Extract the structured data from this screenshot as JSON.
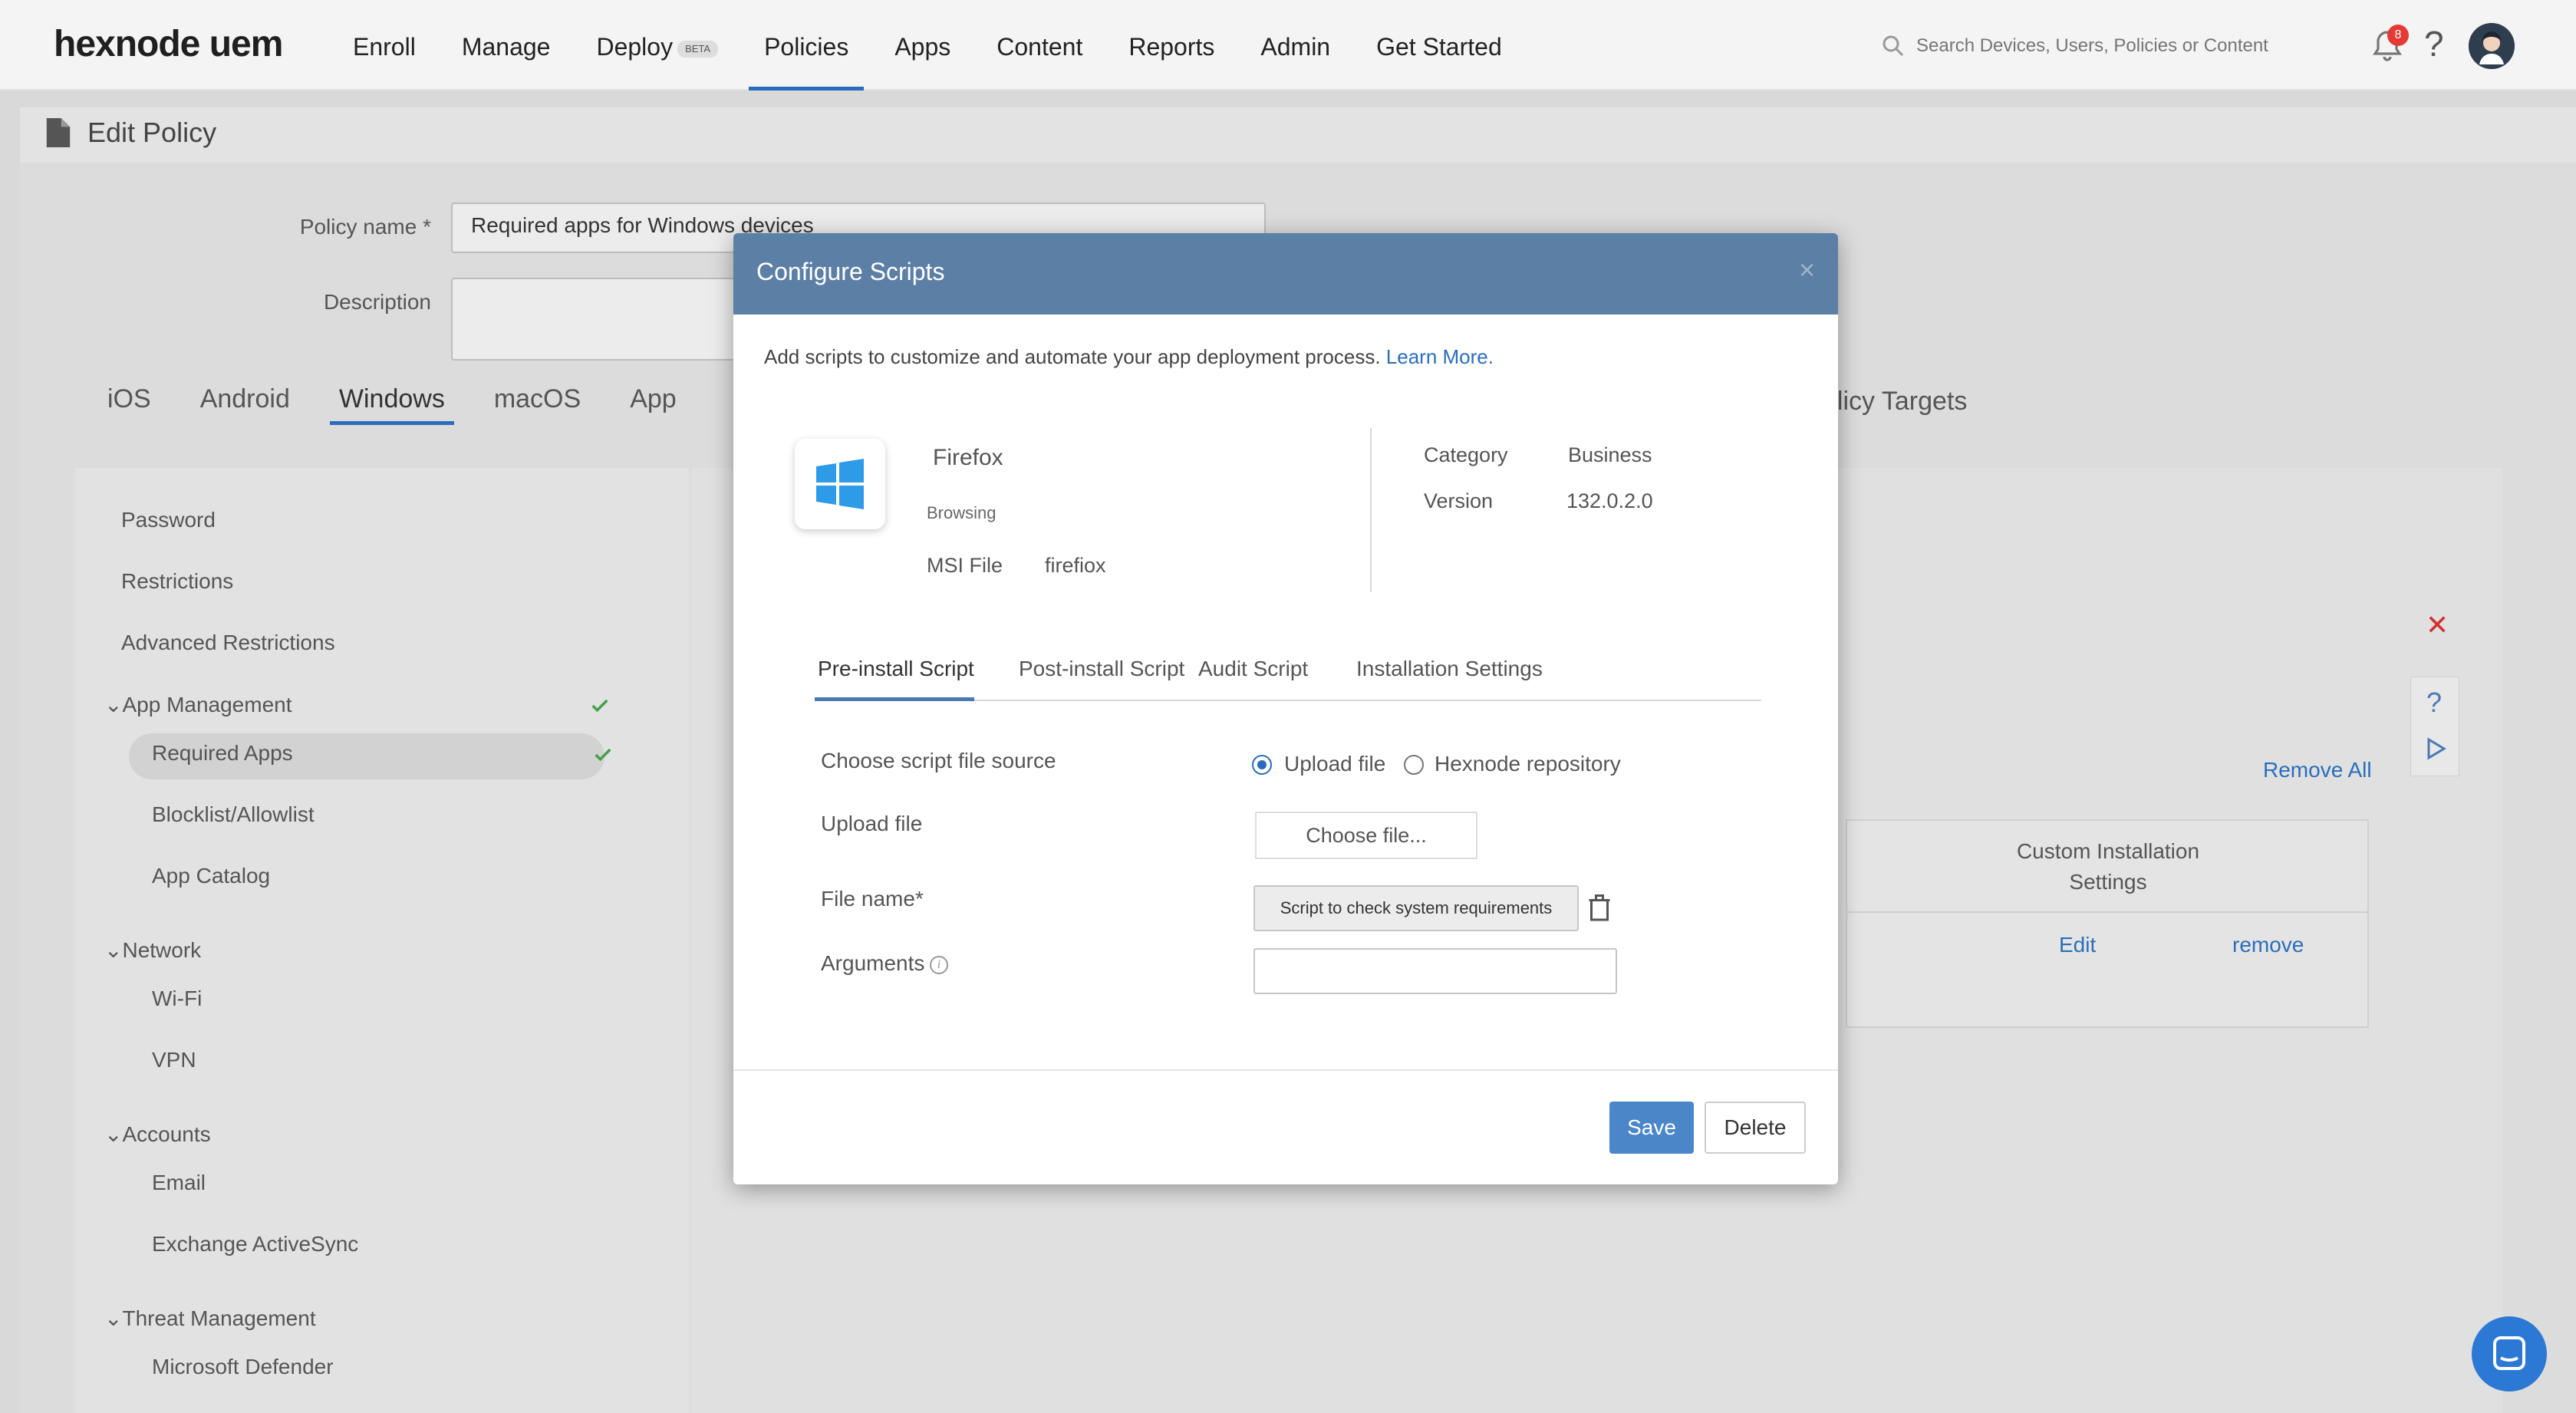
{
  "brand": {
    "logo": "hexnode uem"
  },
  "nav": {
    "items": [
      {
        "label": "Enroll"
      },
      {
        "label": "Manage"
      },
      {
        "label": "Deploy",
        "badge": "BETA"
      },
      {
        "label": "Policies",
        "active": true
      },
      {
        "label": "Apps"
      },
      {
        "label": "Content"
      },
      {
        "label": "Reports"
      },
      {
        "label": "Admin"
      },
      {
        "label": "Get Started"
      }
    ],
    "search_placeholder": "Search Devices, Users, Policies or Content",
    "notification_count": "8",
    "help": "?"
  },
  "page": {
    "title": "Edit Policy",
    "policy_name_label": "Policy name *",
    "policy_name_value": "Required apps for Windows devices",
    "description_label": "Description",
    "os_tabs": [
      "iOS",
      "Android",
      "Windows",
      "macOS",
      "App"
    ],
    "active_os_tab": "Windows",
    "policy_targets": "olicy Targets"
  },
  "sidebar": {
    "items": [
      {
        "label": "Password"
      },
      {
        "label": "Restrictions"
      },
      {
        "label": "Advanced Restrictions"
      }
    ],
    "app_management": {
      "label": "App Management",
      "items": [
        {
          "label": "Required Apps"
        },
        {
          "label": "Blocklist/Allowlist"
        },
        {
          "label": "App Catalog"
        }
      ]
    },
    "network": {
      "label": "Network",
      "items": [
        {
          "label": "Wi-Fi"
        },
        {
          "label": "VPN"
        }
      ]
    },
    "accounts": {
      "label": "Accounts",
      "items": [
        {
          "label": "Email"
        },
        {
          "label": "Exchange ActiveSync"
        }
      ]
    },
    "threat": {
      "label": "Threat Management",
      "items": [
        {
          "label": "Microsoft Defender"
        }
      ]
    }
  },
  "content": {
    "remove_all": "Remove All",
    "column_header_line1": "Custom Installation",
    "column_header_line2": "Settings",
    "row_edit": "Edit",
    "row_remove": "remove"
  },
  "modal": {
    "title": "Configure Scripts",
    "close": "×",
    "intro_text": "Add scripts to customize and automate your app deployment process.",
    "intro_link": "Learn More.",
    "app": {
      "name": "Firefox",
      "category_small": "Browsing",
      "type_label": "MSI File",
      "type_value": "firefiox",
      "category_label": "Category",
      "category_value": "Business",
      "version_label": "Version",
      "version_value": "132.0.2.0"
    },
    "tabs": [
      {
        "label": "Pre-install Script",
        "active": true
      },
      {
        "label": "Post-install Script"
      },
      {
        "label": "Audit Script"
      },
      {
        "label": "Installation Settings"
      }
    ],
    "form": {
      "source_label": "Choose script file source",
      "source_options": [
        {
          "label": "Upload file",
          "checked": true
        },
        {
          "label": "Hexnode repository",
          "checked": false
        }
      ],
      "upload_label": "Upload file",
      "choose_file": "Choose file...",
      "filename_label": "File name*",
      "filename_value": "Script to check system requirements",
      "arguments_label": "Arguments",
      "arguments_value": ""
    },
    "buttons": {
      "save": "Save",
      "delete": "Delete"
    }
  },
  "colors": {
    "accent": "#2a6ebb",
    "modal_header": "#5c7fa6",
    "save_button": "#4a86c8",
    "check_green": "#43a047",
    "notification_red": "#e53935"
  }
}
